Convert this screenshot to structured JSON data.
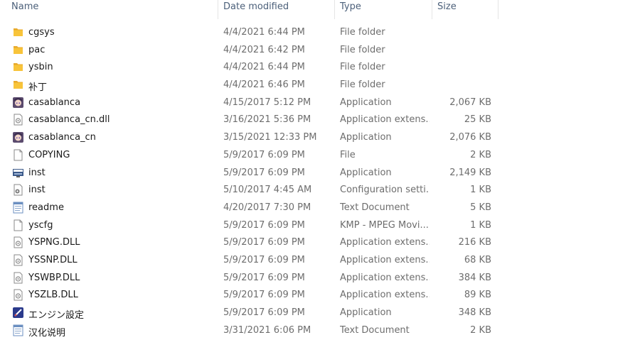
{
  "columns": {
    "name": "Name",
    "date": "Date modified",
    "type": "Type",
    "size": "Size"
  },
  "files": [
    {
      "name": "cgsys",
      "date": "4/4/2021 6:44 PM",
      "type": "File folder",
      "size": "",
      "icon": "folder-icon"
    },
    {
      "name": "pac",
      "date": "4/4/2021 6:42 PM",
      "type": "File folder",
      "size": "",
      "icon": "folder-icon"
    },
    {
      "name": "ysbin",
      "date": "4/4/2021 6:44 PM",
      "type": "File folder",
      "size": "",
      "icon": "folder-icon"
    },
    {
      "name": "补丁",
      "date": "4/4/2021 6:46 PM",
      "type": "File folder",
      "size": "",
      "icon": "folder-icon"
    },
    {
      "name": "casablanca",
      "date": "4/15/2017 5:12 PM",
      "type": "Application",
      "size": "2,067 KB",
      "icon": "app-character-icon"
    },
    {
      "name": "casablanca_cn.dll",
      "date": "3/16/2021 5:36 PM",
      "type": "Application extens...",
      "size": "25 KB",
      "icon": "dll-icon"
    },
    {
      "name": "casablanca_cn",
      "date": "3/15/2021 12:33 PM",
      "type": "Application",
      "size": "2,076 KB",
      "icon": "app-character-icon"
    },
    {
      "name": "COPYING",
      "date": "5/9/2017 6:09 PM",
      "type": "File",
      "size": "2 KB",
      "icon": "file-icon"
    },
    {
      "name": "inst",
      "date": "5/9/2017 6:09 PM",
      "type": "Application",
      "size": "2,149 KB",
      "icon": "installer-icon"
    },
    {
      "name": "inst",
      "date": "5/10/2017 4:45 AM",
      "type": "Configuration setti...",
      "size": "1 KB",
      "icon": "config-icon"
    },
    {
      "name": "readme",
      "date": "4/20/2017 7:30 PM",
      "type": "Text Document",
      "size": "5 KB",
      "icon": "text-document-icon"
    },
    {
      "name": "yscfg",
      "date": "5/9/2017 6:09 PM",
      "type": "KMP - MPEG Movi...",
      "size": "1 KB",
      "icon": "file-icon"
    },
    {
      "name": "YSPNG.DLL",
      "date": "5/9/2017 6:09 PM",
      "type": "Application extens...",
      "size": "216 KB",
      "icon": "dll-icon"
    },
    {
      "name": "YSSNP.DLL",
      "date": "5/9/2017 6:09 PM",
      "type": "Application extens...",
      "size": "68 KB",
      "icon": "dll-icon"
    },
    {
      "name": "YSWBP.DLL",
      "date": "5/9/2017 6:09 PM",
      "type": "Application extens...",
      "size": "384 KB",
      "icon": "dll-icon"
    },
    {
      "name": "YSZLB.DLL",
      "date": "5/9/2017 6:09 PM",
      "type": "Application extens...",
      "size": "89 KB",
      "icon": "dll-icon"
    },
    {
      "name": "エンジン設定",
      "date": "5/9/2017 6:09 PM",
      "type": "Application",
      "size": "348 KB",
      "icon": "settings-app-icon"
    },
    {
      "name": "汉化说明",
      "date": "3/31/2021 6:06 PM",
      "type": "Text Document",
      "size": "2 KB",
      "icon": "text-document-icon"
    }
  ],
  "colors": {
    "folder": "#f8c43a",
    "header_text": "#4c607a",
    "secondary_text": "#6d6d6d",
    "divider": "#e5e5e5"
  }
}
